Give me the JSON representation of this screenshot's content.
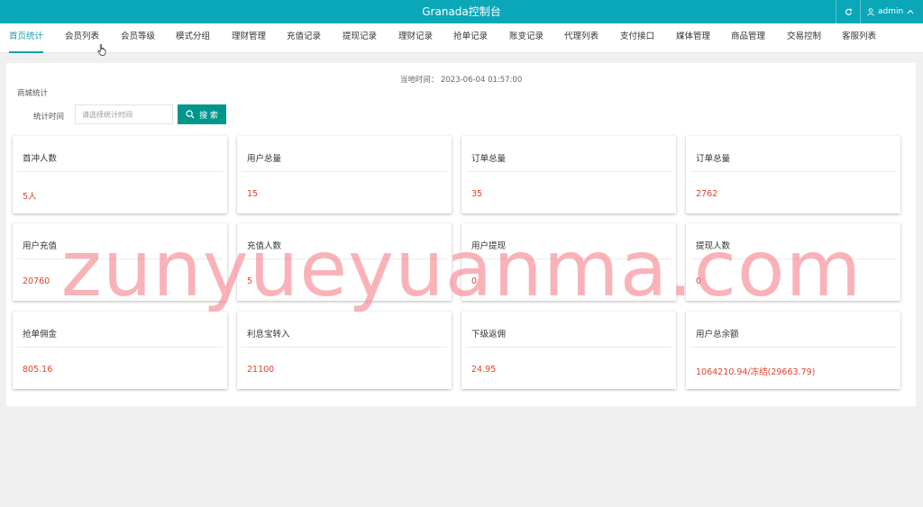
{
  "header": {
    "title": "Granada控制台",
    "user": "admin",
    "color": "#0aa7b8"
  },
  "nav": {
    "tabs": [
      "首页统计",
      "会员列表",
      "会员等级",
      "模式分组",
      "理财管理",
      "充值记录",
      "提现记录",
      "理财记录",
      "抢单记录",
      "账变记录",
      "代理列表",
      "支付接口",
      "媒体管理",
      "商品管理",
      "交易控制",
      "客服列表"
    ],
    "active_index": 0
  },
  "stats": {
    "time_label": "当地时间：",
    "time_value": "2023-06-04 01:57:00",
    "section_title": "商城统计",
    "filter_label": "统计时间",
    "filter_placeholder": "请选择统计时间",
    "search_label": "搜 索",
    "accent_color": "#00968b",
    "value_color": "#e0432c"
  },
  "cards": [
    {
      "label": "首冲人数",
      "value": "5人"
    },
    {
      "label": "用户总量",
      "value": "15"
    },
    {
      "label": "订单总量",
      "value": "35"
    },
    {
      "label": "订单总量",
      "value": "2762"
    },
    {
      "label": "用户充值",
      "value": "20760"
    },
    {
      "label": "充值人数",
      "value": "5"
    },
    {
      "label": "用户提现",
      "value": "0"
    },
    {
      "label": "提现人数",
      "value": "0"
    },
    {
      "label": "抢单佣金",
      "value": "805.16"
    },
    {
      "label": "利息宝转入",
      "value": "21100"
    },
    {
      "label": "下级返佣",
      "value": "24.95"
    },
    {
      "label": "用户总余额",
      "value": "1064210.94/冻结(29663.79)"
    }
  ],
  "watermark": "zunyueyuanma.com"
}
